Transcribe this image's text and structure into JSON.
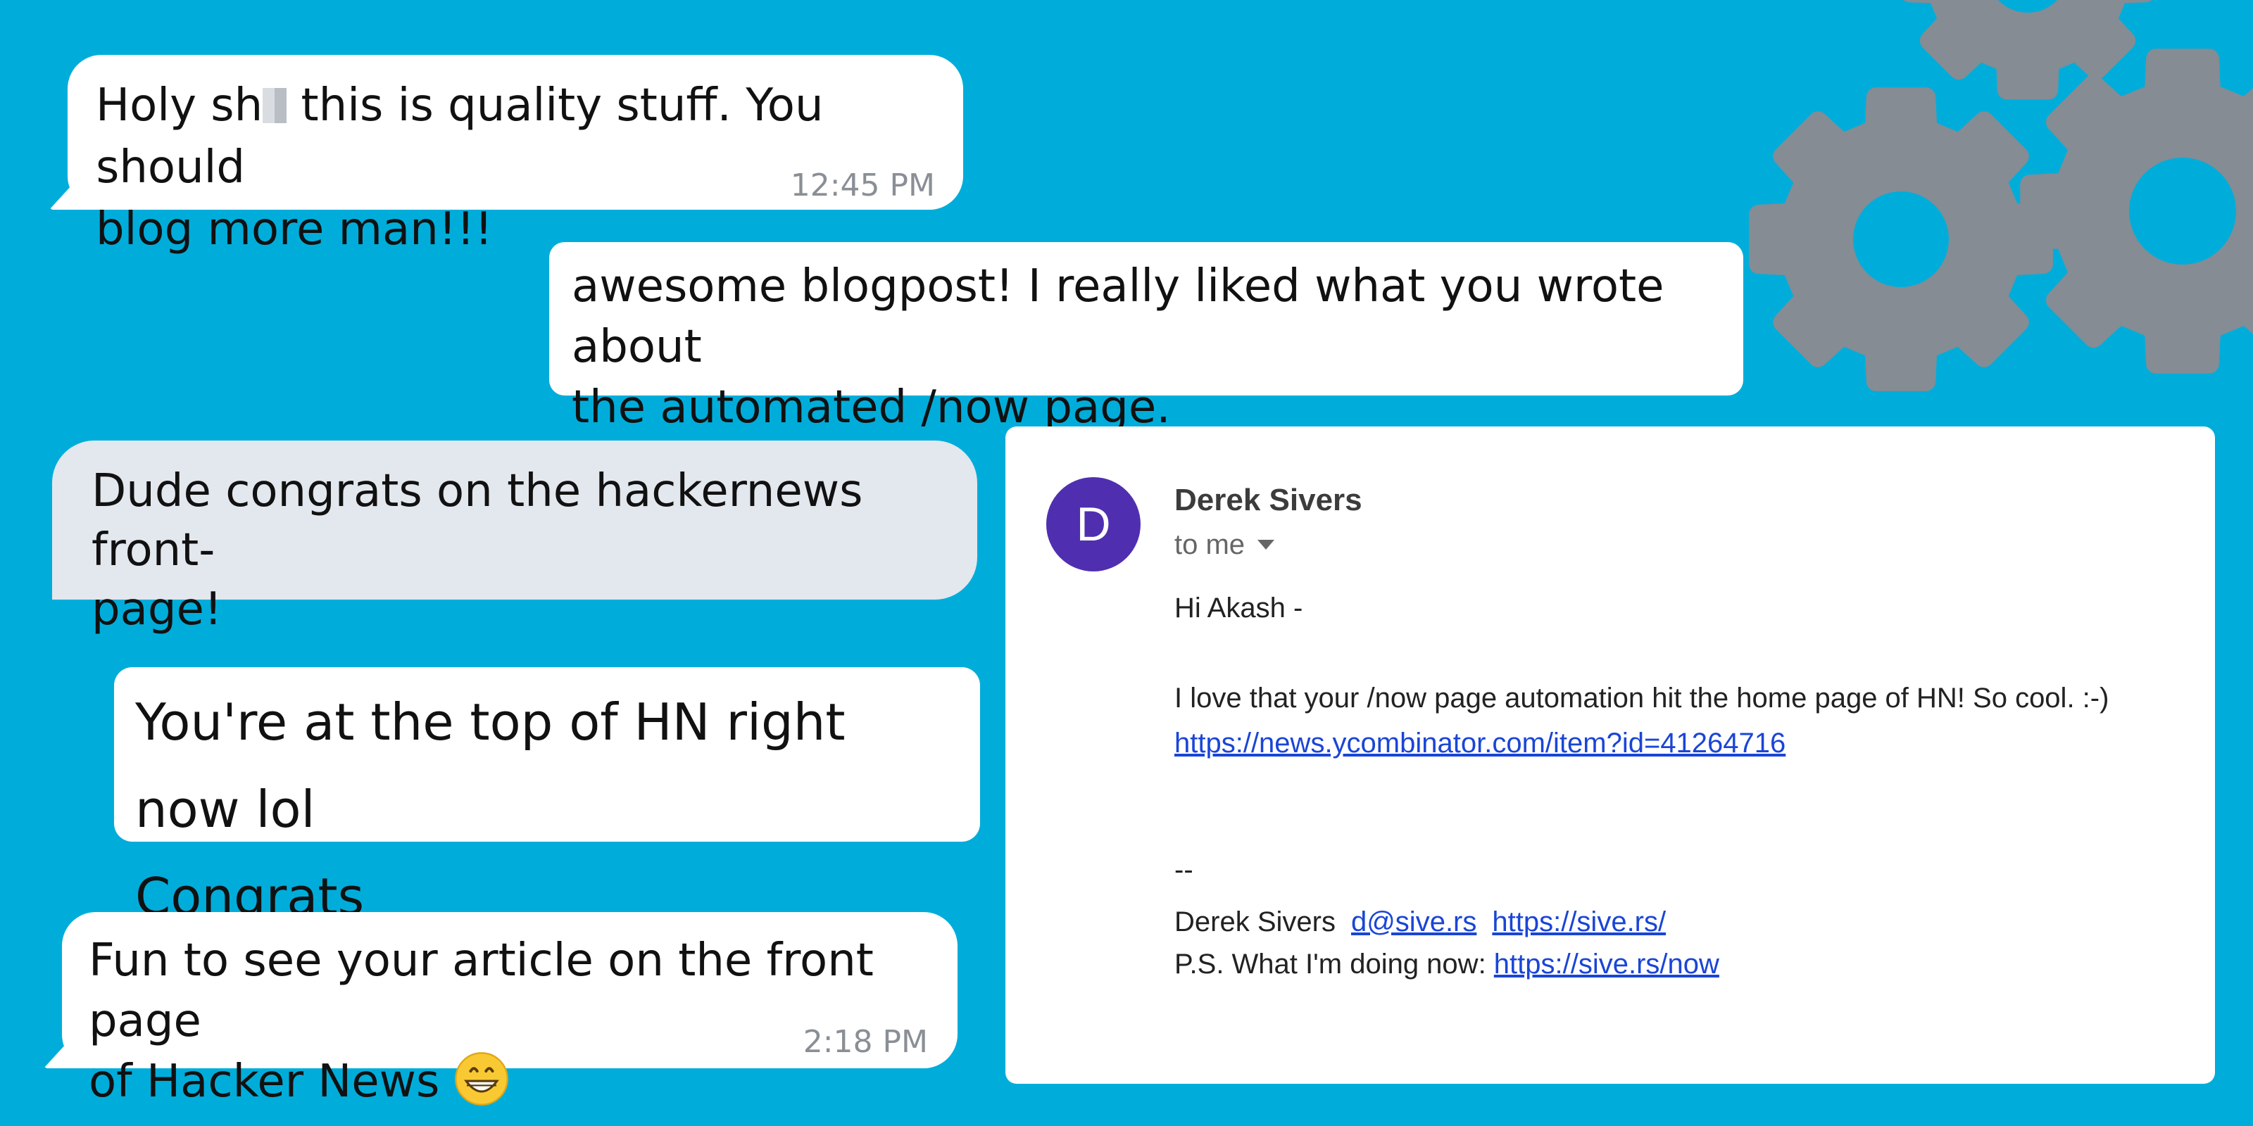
{
  "colors": {
    "background": "#00ADDA",
    "bubble": "#FFFFFF",
    "grey_bubble": "#E3E7EE",
    "gear": "#858C94",
    "avatar": "#4F2FB0",
    "link": "#1A45D6"
  },
  "messages": {
    "m1": {
      "line1_a": "Holy sh",
      "line1_b": " this is quality stuff. You should",
      "line2": "blog more man!!!",
      "time": "12:45 PM"
    },
    "m2": {
      "line1": "awesome blogpost! I really liked what you wrote about",
      "line2": "the automated /now page."
    },
    "m3": {
      "line1": "Dude congrats on the hackernews front-",
      "line2": "page!"
    },
    "m4": {
      "line1": "You're at the top of HN right now lol",
      "line2": "Congrats"
    },
    "m5": {
      "line1": "Fun to see your article on the front page",
      "line2": "of Hacker News",
      "emoji": "grinning-face-icon",
      "time": "2:18 PM"
    }
  },
  "email": {
    "avatar_letter": "D",
    "sender": "Derek Sivers",
    "recipient": "to me",
    "greeting": "Hi Akash -",
    "body": "I love that your /now page automation hit the home page of HN! So cool. :-)",
    "link": "https://news.ycombinator.com/item?id=41264716",
    "separator": "--",
    "signature_name": "Derek Sivers",
    "signature_email": "d@sive.rs",
    "signature_site": "https://sive.rs/",
    "ps_text": "P.S. What I'm doing now: ",
    "ps_link": "https://sive.rs/now"
  }
}
